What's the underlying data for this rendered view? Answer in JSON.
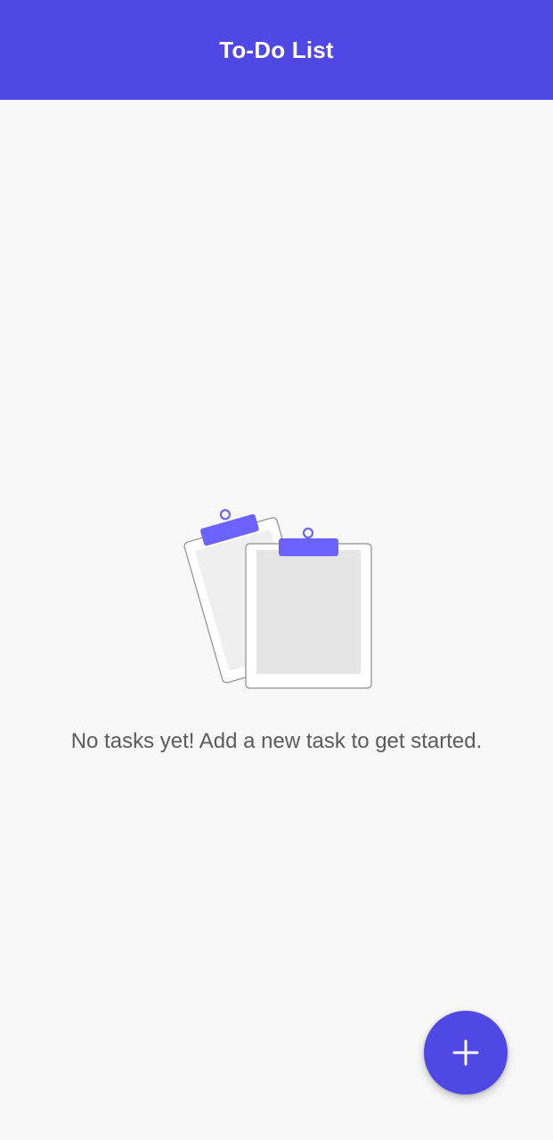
{
  "app_bar": {
    "title": "To-Do List"
  },
  "empty_state": {
    "illustration_icon": "clipboards-icon",
    "message": "No tasks yet! Add a new task to get started."
  },
  "fab": {
    "icon": "plus-icon"
  },
  "colors": {
    "primary": "#5048E5",
    "clip": "#6C63FF",
    "background": "#F8F8F8",
    "message_text": "#5B5B5B"
  }
}
